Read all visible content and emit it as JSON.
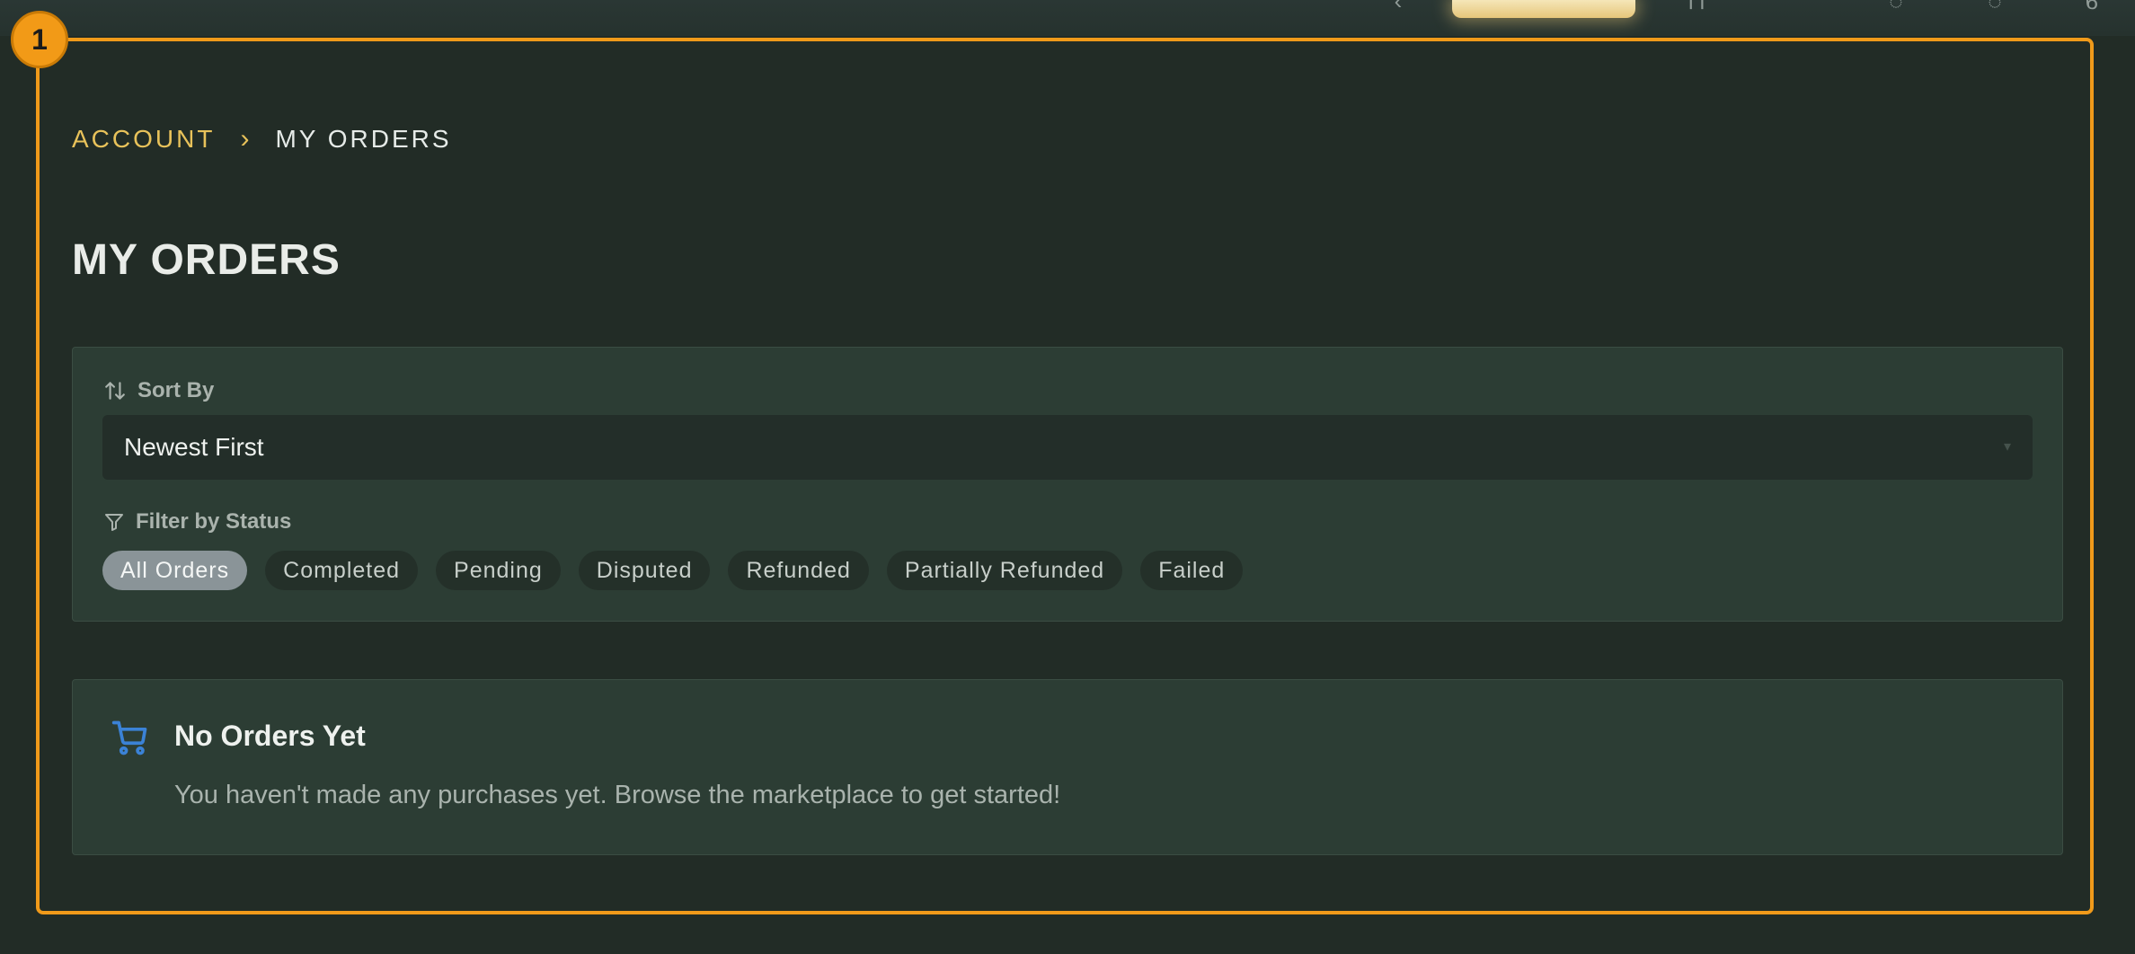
{
  "step_badge": "1",
  "breadcrumb": {
    "parent": "ACCOUNT",
    "separator": "›",
    "current": "MY ORDERS"
  },
  "page": {
    "title": "MY ORDERS"
  },
  "sort": {
    "label": "Sort By",
    "value": "Newest First"
  },
  "filter": {
    "label": "Filter by Status",
    "options": [
      "All Orders",
      "Completed",
      "Pending",
      "Disputed",
      "Refunded",
      "Partially Refunded",
      "Failed"
    ],
    "selected": "All Orders"
  },
  "empty_state": {
    "title": "No Orders Yet",
    "message": "You haven't made any purchases yet. Browse the marketplace to get started!"
  },
  "icons": [
    "sort-icon",
    "filter-icon",
    "cart-icon",
    "chevron-down-icon"
  ],
  "colors": {
    "accent": "#f09a1a",
    "breadcrumb_link": "#e8c25a",
    "cart_icon": "#3b82d6",
    "chip_active": "#8a9498"
  }
}
